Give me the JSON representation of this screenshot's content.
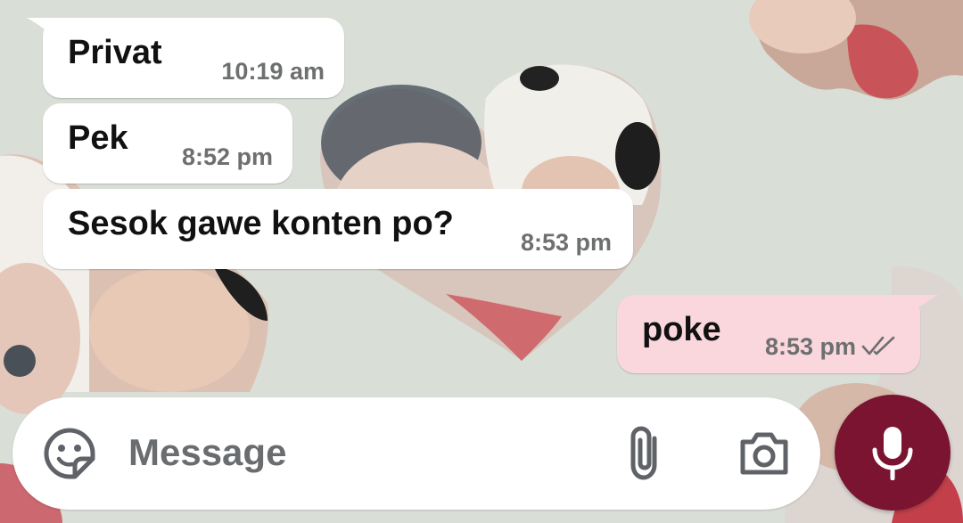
{
  "messages": [
    {
      "text": "Privat",
      "time": "10:19 am",
      "direction": "incoming"
    },
    {
      "text": "Pek",
      "time": "8:52 pm",
      "direction": "incoming"
    },
    {
      "text": "Sesok gawe konten po?",
      "time": "8:53 pm",
      "direction": "incoming"
    },
    {
      "text": "poke",
      "time": "8:53 pm",
      "direction": "outgoing",
      "status": "read"
    }
  ],
  "composer": {
    "placeholder": "Message",
    "sticker_icon": "sticker-icon",
    "attach_icon": "paperclip-icon",
    "camera_icon": "camera-icon",
    "mic_icon": "microphone-icon"
  },
  "colors": {
    "chat_background": "#d9ded7",
    "incoming_bubble": "#ffffff",
    "outgoing_bubble": "#f9d7dd",
    "mic_button": "#7a1430"
  }
}
